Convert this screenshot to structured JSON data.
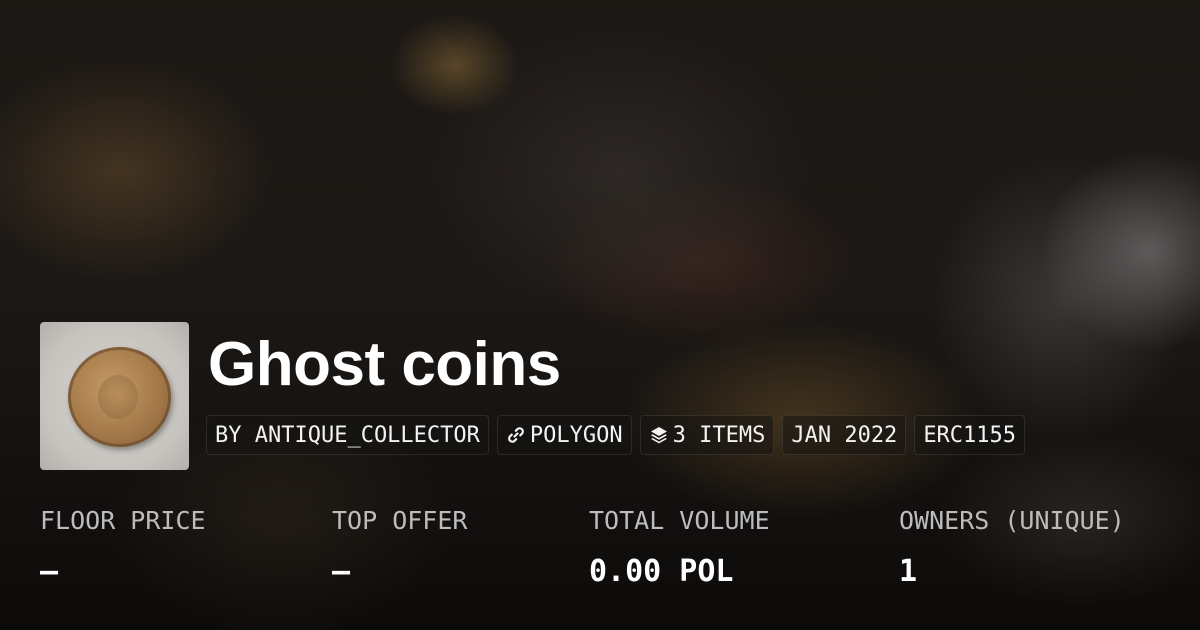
{
  "collection": {
    "title": "Ghost coins",
    "creator": "BY ANTIQUE_COLLECTOR",
    "chain": "POLYGON",
    "items": "3 ITEMS",
    "date": "JAN 2022",
    "standard": "ERC1155",
    "icons": {
      "chain": "link-icon",
      "items": "layers-icon"
    }
  },
  "stats": {
    "floor_price": {
      "label": "FLOOR PRICE",
      "value": "–"
    },
    "top_offer": {
      "label": "TOP OFFER",
      "value": "–"
    },
    "total_volume": {
      "label": "TOTAL VOLUME",
      "value": "0.00 POL"
    },
    "owners": {
      "label": "OWNERS (UNIQUE)",
      "value": "1"
    }
  }
}
